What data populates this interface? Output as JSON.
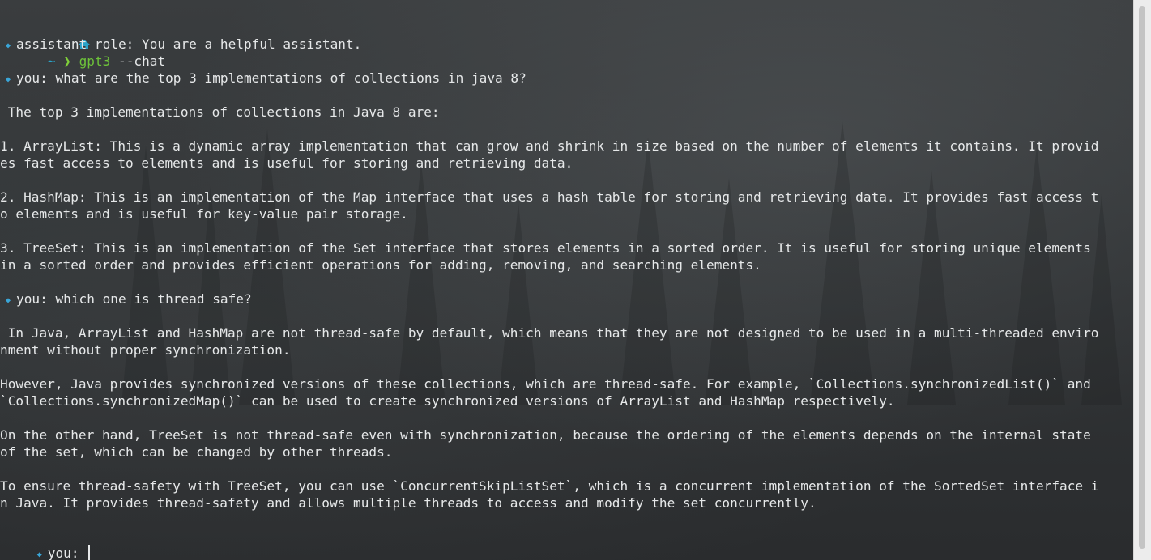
{
  "prompt": {
    "home_icon": "home-icon",
    "tilde": "~",
    "chevron": "❯",
    "command": "gpt3",
    "flags": " --chat"
  },
  "bullet_glyph": "◆",
  "lines": [
    {
      "kind": "role",
      "text": "assistant role: You are a helpful assistant."
    },
    {
      "kind": "user",
      "text": "you: what are the top 3 implementations of collections in java 8?"
    },
    {
      "kind": "text",
      "text": " The top 3 implementations of collections in Java 8 are:"
    },
    {
      "kind": "text",
      "text": "1. ArrayList: This is a dynamic array implementation that can grow and shrink in size based on the number of elements it contains. It provid"
    },
    {
      "kind": "text",
      "text": "es fast access to elements and is useful for storing and retrieving data."
    },
    {
      "kind": "text",
      "text": "2. HashMap: This is an implementation of the Map interface that uses a hash table for storing and retrieving data. It provides fast access t"
    },
    {
      "kind": "text",
      "text": "o elements and is useful for key-value pair storage."
    },
    {
      "kind": "text",
      "text": "3. TreeSet: This is an implementation of the Set interface that stores elements in a sorted order. It is useful for storing unique elements"
    },
    {
      "kind": "text",
      "text": "in a sorted order and provides efficient operations for adding, removing, and searching elements."
    },
    {
      "kind": "user",
      "text": "you: which one is thread safe?"
    },
    {
      "kind": "text",
      "text": " In Java, ArrayList and HashMap are not thread-safe by default, which means that they are not designed to be used in a multi-threaded enviro"
    },
    {
      "kind": "text",
      "text": "nment without proper synchronization."
    },
    {
      "kind": "text",
      "text": "However, Java provides synchronized versions of these collections, which are thread-safe. For example, `Collections.synchronizedList()` and"
    },
    {
      "kind": "text",
      "text": "`Collections.synchronizedMap()` can be used to create synchronized versions of ArrayList and HashMap respectively."
    },
    {
      "kind": "text",
      "text": "On the other hand, TreeSet is not thread-safe even with synchronization, because the ordering of the elements depends on the internal state"
    },
    {
      "kind": "text",
      "text": "of the set, which can be changed by other threads."
    },
    {
      "kind": "text",
      "text": "To ensure thread-safety with TreeSet, you can use `ConcurrentSkipListSet`, which is a concurrent implementation of the SortedSet interface i"
    },
    {
      "kind": "text",
      "text": "n Java. It provides thread-safety and allows multiple threads to access and modify the set concurrently."
    }
  ],
  "input_prompt": "you: ",
  "colors": {
    "bullet": "#3aa6d8",
    "command": "#6dc23a",
    "path": "#2aa3c9",
    "text": "#e6e8e9"
  }
}
